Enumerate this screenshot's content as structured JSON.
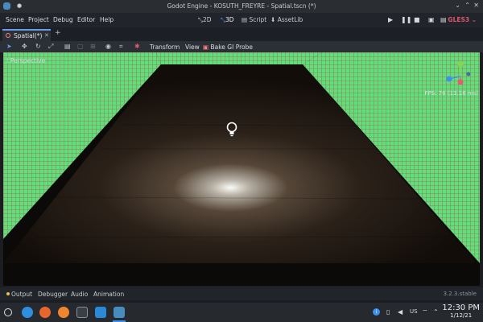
{
  "window": {
    "title": "Godot Engine - KOSUTH_FREYRE - Spatial.tscn (*)"
  },
  "menubar": {
    "items": [
      "Scene",
      "Project",
      "Debug",
      "Editor",
      "Help"
    ],
    "modes": [
      "2D",
      "3D",
      "Script",
      "AssetLib"
    ],
    "active_mode": "3D",
    "renderer": "GLES3 ⌄"
  },
  "tabs": {
    "scene_tab": "Spatial(*)",
    "close": "✕",
    "add": "+"
  },
  "toolbar": {
    "transform": "Transform",
    "view": "View",
    "bake": "Bake GI Probe"
  },
  "viewport": {
    "label": "Perspective",
    "fps": "FPS: 76 (13.16 ms)"
  },
  "bottom_panel": {
    "tabs": [
      "Output",
      "Debugger",
      "Audio",
      "Animation"
    ],
    "version": "3.2.3.stable"
  },
  "taskbar": {
    "locale": "US",
    "time": "12:30 PM",
    "date": "1/12/21"
  },
  "colors": {
    "accent": "#699ce8",
    "wall_grid": "#5ee07a",
    "renderer": "#e0566b"
  }
}
